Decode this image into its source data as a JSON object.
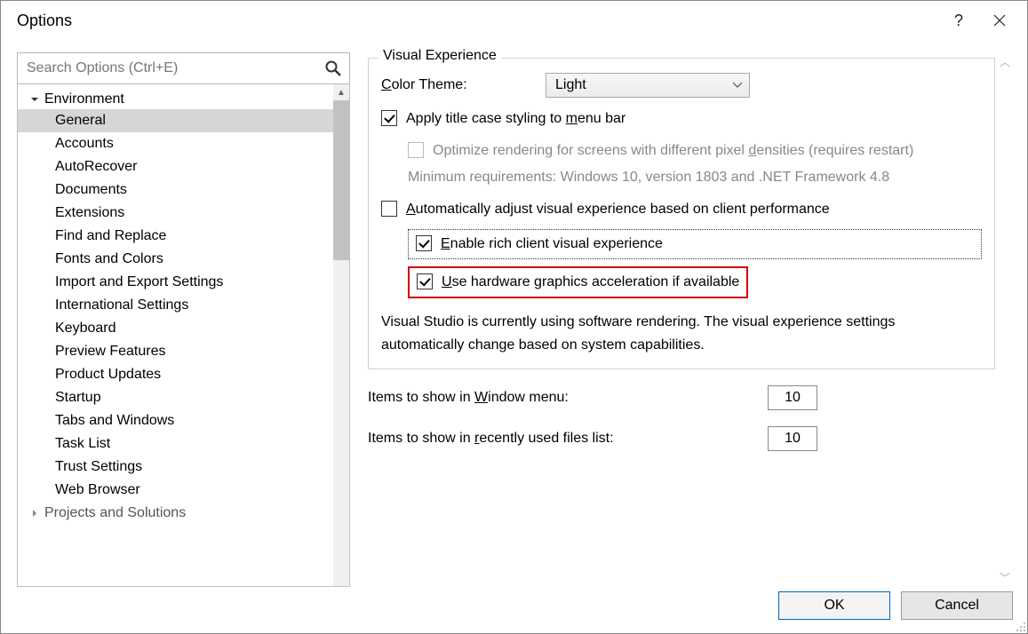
{
  "title": "Options",
  "search_placeholder": "Search Options (Ctrl+E)",
  "tree": {
    "group": "Environment",
    "items": [
      "General",
      "Accounts",
      "AutoRecover",
      "Documents",
      "Extensions",
      "Find and Replace",
      "Fonts and Colors",
      "Import and Export Settings",
      "International Settings",
      "Keyboard",
      "Preview Features",
      "Product Updates",
      "Startup",
      "Tabs and Windows",
      "Task List",
      "Trust Settings",
      "Web Browser"
    ],
    "next_group_truncated": "Projects and Solutions",
    "selected_index": 0
  },
  "visual": {
    "legend": "Visual Experience",
    "color_theme_label": "Color Theme:",
    "color_theme_value": "Light",
    "titlecase": "Apply title case styling to menu bar",
    "optimize": "Optimize rendering for screens with different pixel densities (requires restart)",
    "minreq": "Minimum requirements: Windows 10, version 1803 and .NET Framework 4.8",
    "auto": "Automatically adjust visual experience based on client performance",
    "rich": "Enable rich client visual experience",
    "hw": "Use hardware graphics acceleration if available",
    "status": "Visual Studio is currently using software rendering.  The visual experience settings automatically change based on system capabilities."
  },
  "window_items_label": "Items to show in Window menu:",
  "window_items_value": "10",
  "recent_items_label": "Items to show in recently used files list:",
  "recent_items_value": "10",
  "buttons": {
    "ok": "OK",
    "cancel": "Cancel"
  }
}
